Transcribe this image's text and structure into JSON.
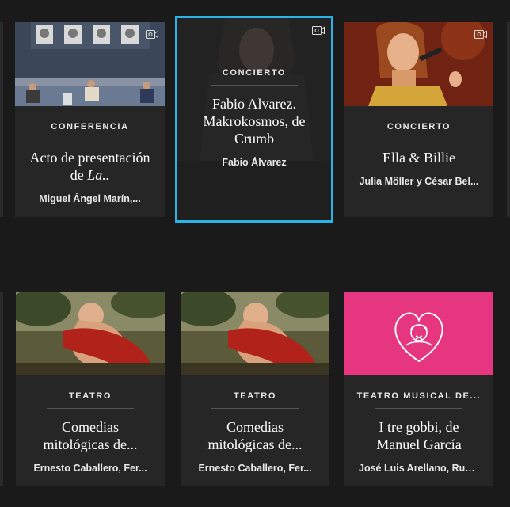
{
  "cards": [
    {
      "category": "CONFERENCIA",
      "title": "Acto de presentación de",
      "title_italic": "La..",
      "author": "Miguel Ángel Marín,...",
      "has_video": true
    },
    {
      "category": "CONCIERTO",
      "title": "Fabio Alvarez. Makrokosmos, de Crumb",
      "author": "Fabio Álvarez",
      "has_video": true,
      "selected": true
    },
    {
      "category": "CONCIERTO",
      "title": "Ella & Billie",
      "author": "Julia Möller y César Bel...",
      "has_video": true
    },
    {
      "category": "TEATRO",
      "title": "Comedias mitológicas de...",
      "author": "Ernesto Caballero, Fer...",
      "has_video": false
    },
    {
      "category": "TEATRO",
      "title": "Comedias mitológicas de...",
      "author": "Ernesto Caballero, Fer...",
      "has_video": false
    },
    {
      "category": "TEATRO MUSICAL DE...",
      "title": "I tre gobbi, de Manuel García",
      "author": "José Luis Arellano, Rub...",
      "has_video": false
    }
  ],
  "colors": {
    "selection_border": "#2ab3e6",
    "pink_thumb": "#e5367f",
    "card_bg": "#262626",
    "page_bg": "#1a1a1a"
  },
  "icons": [
    "video-camera-icon",
    "heart-logo-icon"
  ]
}
